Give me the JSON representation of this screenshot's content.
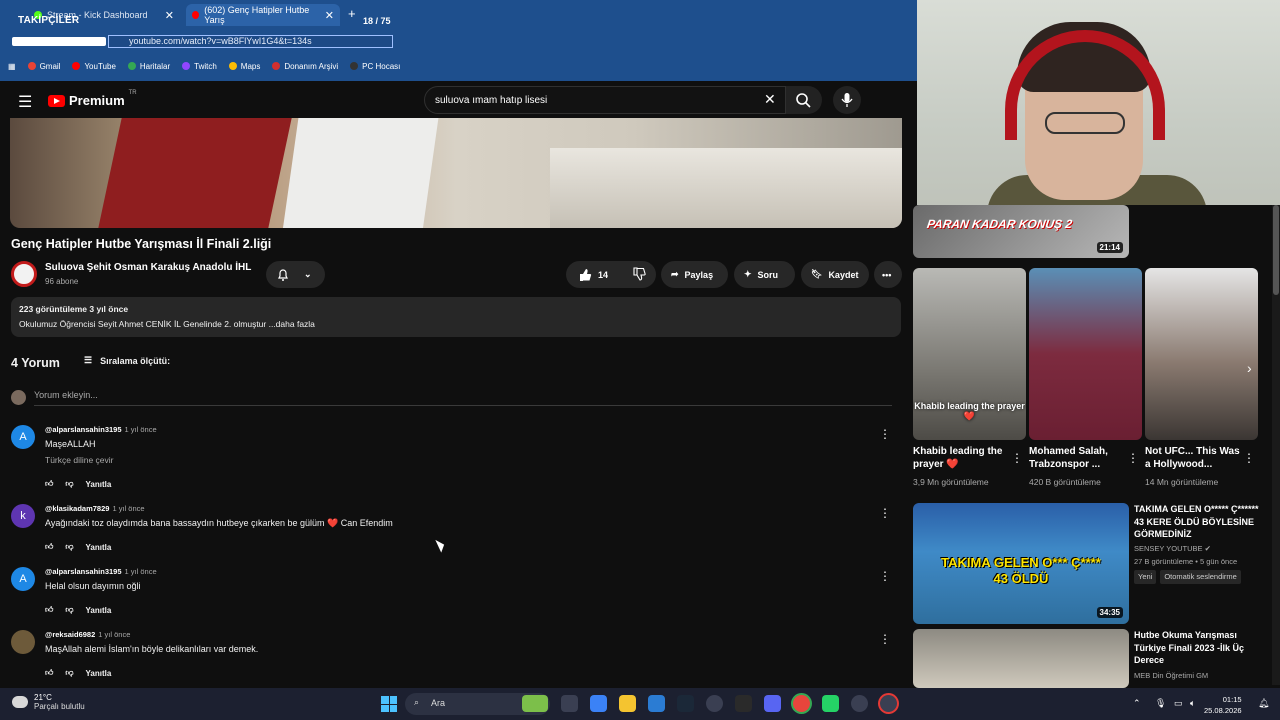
{
  "browser": {
    "tabs": [
      {
        "label": "Stream - Kick Dashboard",
        "active": false
      },
      {
        "label": "(602) Genç Hatipler Hutbe Yarış",
        "active": true
      }
    ],
    "overlay_label": "TAKİPÇİLER",
    "overlay_count": "18 / 75",
    "url": "youtube.com/watch?v=wB8FlYwI1G4&t=134s",
    "bookmarks": [
      "Gmail",
      "YouTube",
      "Haritalar",
      "Twitch",
      "Maps",
      "Donanım Arşivi",
      "PC Hocası"
    ]
  },
  "youtube": {
    "logo": "Premium",
    "region": "TR",
    "search_query": "suluova ımam hatıp lisesi"
  },
  "video": {
    "title": "Genç Hatipler Hutbe Yarışması İl Finali 2.liği",
    "channel": "Suluova Şehit Osman Karakuş Anadolu İHL",
    "subscribers": "96 abone",
    "likes": "14",
    "share_label": "Paylaş",
    "ask_label": "Soru",
    "save_label": "Kaydet",
    "description_meta": "223 görüntüleme  3 yıl önce",
    "description_text": "Okulumuz Öğrencisi Seyit Ahmet CENİK İL Genelinde 2. olmuştur ...daha fazla"
  },
  "comments_section": {
    "count_label": "4 Yorum",
    "sort_label": "Sıralama ölçütü:",
    "add_placeholder": "Yorum ekleyin...",
    "reply_label": "Yanıtla",
    "comments": [
      {
        "avatar": "A",
        "color": "#1e88e5",
        "user": "@alparslansahin3195",
        "time": "1 yıl önce",
        "text": "MaşeALLAH",
        "translate": "Türkçe diline çevir"
      },
      {
        "avatar": "k",
        "color": "#5e35b1",
        "user": "@klasikadam7829",
        "time": "1 yıl önce",
        "text": "Ayağındaki toz olaydımda bana bassaydın hutbeye çıkarken be gülüm ❤️ Can  Efendim"
      },
      {
        "avatar": "A",
        "color": "#1e88e5",
        "user": "@alparslansahin3195",
        "time": "1 yıl önce",
        "text": "Helal olsun dayımın oğli"
      },
      {
        "avatar": "",
        "color": "#6d5a3a",
        "user": "@reksaid6982",
        "time": "1 yıl önce",
        "text": "MaşAllah alemi İslam'ın böyle delikanlıları var demek."
      }
    ]
  },
  "sidebar": {
    "top_thumb_text": "PARAN KADAR KONUŞ 2",
    "top_thumb_duration": "21:14",
    "shorts": [
      {
        "title": "Khabib leading the prayer ❤️",
        "views": "3,9 Mn görüntüleme",
        "overlay": "Khabib leading the prayer ❤️"
      },
      {
        "title": "Mohamed Salah, Trabzonspor ...",
        "views": "420 B görüntüleme",
        "overlay": ""
      },
      {
        "title": "Not UFC... This Was a Hollywood...",
        "views": "14 Mn görüntüleme",
        "overlay": ""
      }
    ],
    "videos": [
      {
        "title": "TAKIMA GELEN O***** Ç****** 43 KERE ÖLDÜ BÖYLESİNE GÖRMEDİNİZ",
        "channel": "SENSEY YOUTUBE",
        "meta": "27 B görüntüleme • 5 gün önce",
        "badges": [
          "Yeni",
          "Otomatik seslendirme"
        ],
        "thumb_text": "TAKIMA GELEN O*** Ç****\n43 ÖLDÜ",
        "duration": "34:35"
      },
      {
        "title": "Hutbe Okuma Yarışması Türkiye Finali 2023 -İlk Üç Derece",
        "channel": "MEB Din Öğretimi GM",
        "meta": "",
        "badges": [],
        "thumb_text": "",
        "duration": ""
      }
    ]
  },
  "taskbar": {
    "temp": "21°C",
    "weather": "Parçalı bulutlu",
    "search": "Ara",
    "time": "01:15",
    "date": "25.08.2026"
  }
}
